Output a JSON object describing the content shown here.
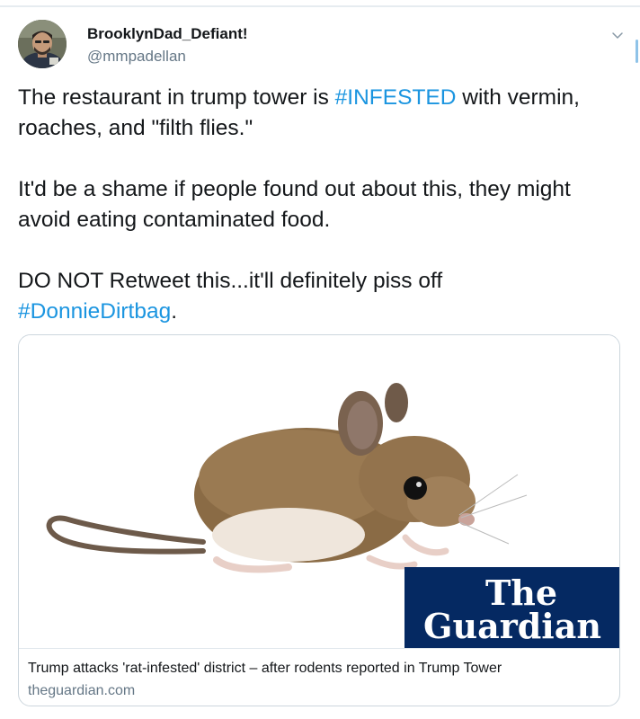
{
  "tweet": {
    "author_name": "BrooklynDad_Defiant!",
    "author_handle": "@mmpadellan",
    "text_lines": {
      "l1_pre": "The restaurant in trump tower is ",
      "l1_tag": "#INFESTED",
      "l1_post": " with vermin,",
      "l2": "roaches, and \"filth flies.\"",
      "l3": "It'd be a shame if people found out about this, they might",
      "l4": "avoid eating contaminated food.",
      "l5": "DO NOT Retweet this...it'll definitely piss off",
      "l6_tag": "#DonnieDirtbag",
      "l6_post": "."
    },
    "icons": {
      "avatar": "avatar",
      "caret": "chevron-down-icon",
      "logo": "guardian-logo"
    }
  },
  "card": {
    "logo_line1": "The",
    "logo_line2": "Guardian",
    "title": "Trump attacks 'rat-infested' district – after rodents reported in Trump Tower",
    "domain": "theguardian.com"
  },
  "colors": {
    "hashtag": "#1b95e0",
    "guardian_blue": "#052962",
    "secondary_text": "#657786"
  }
}
